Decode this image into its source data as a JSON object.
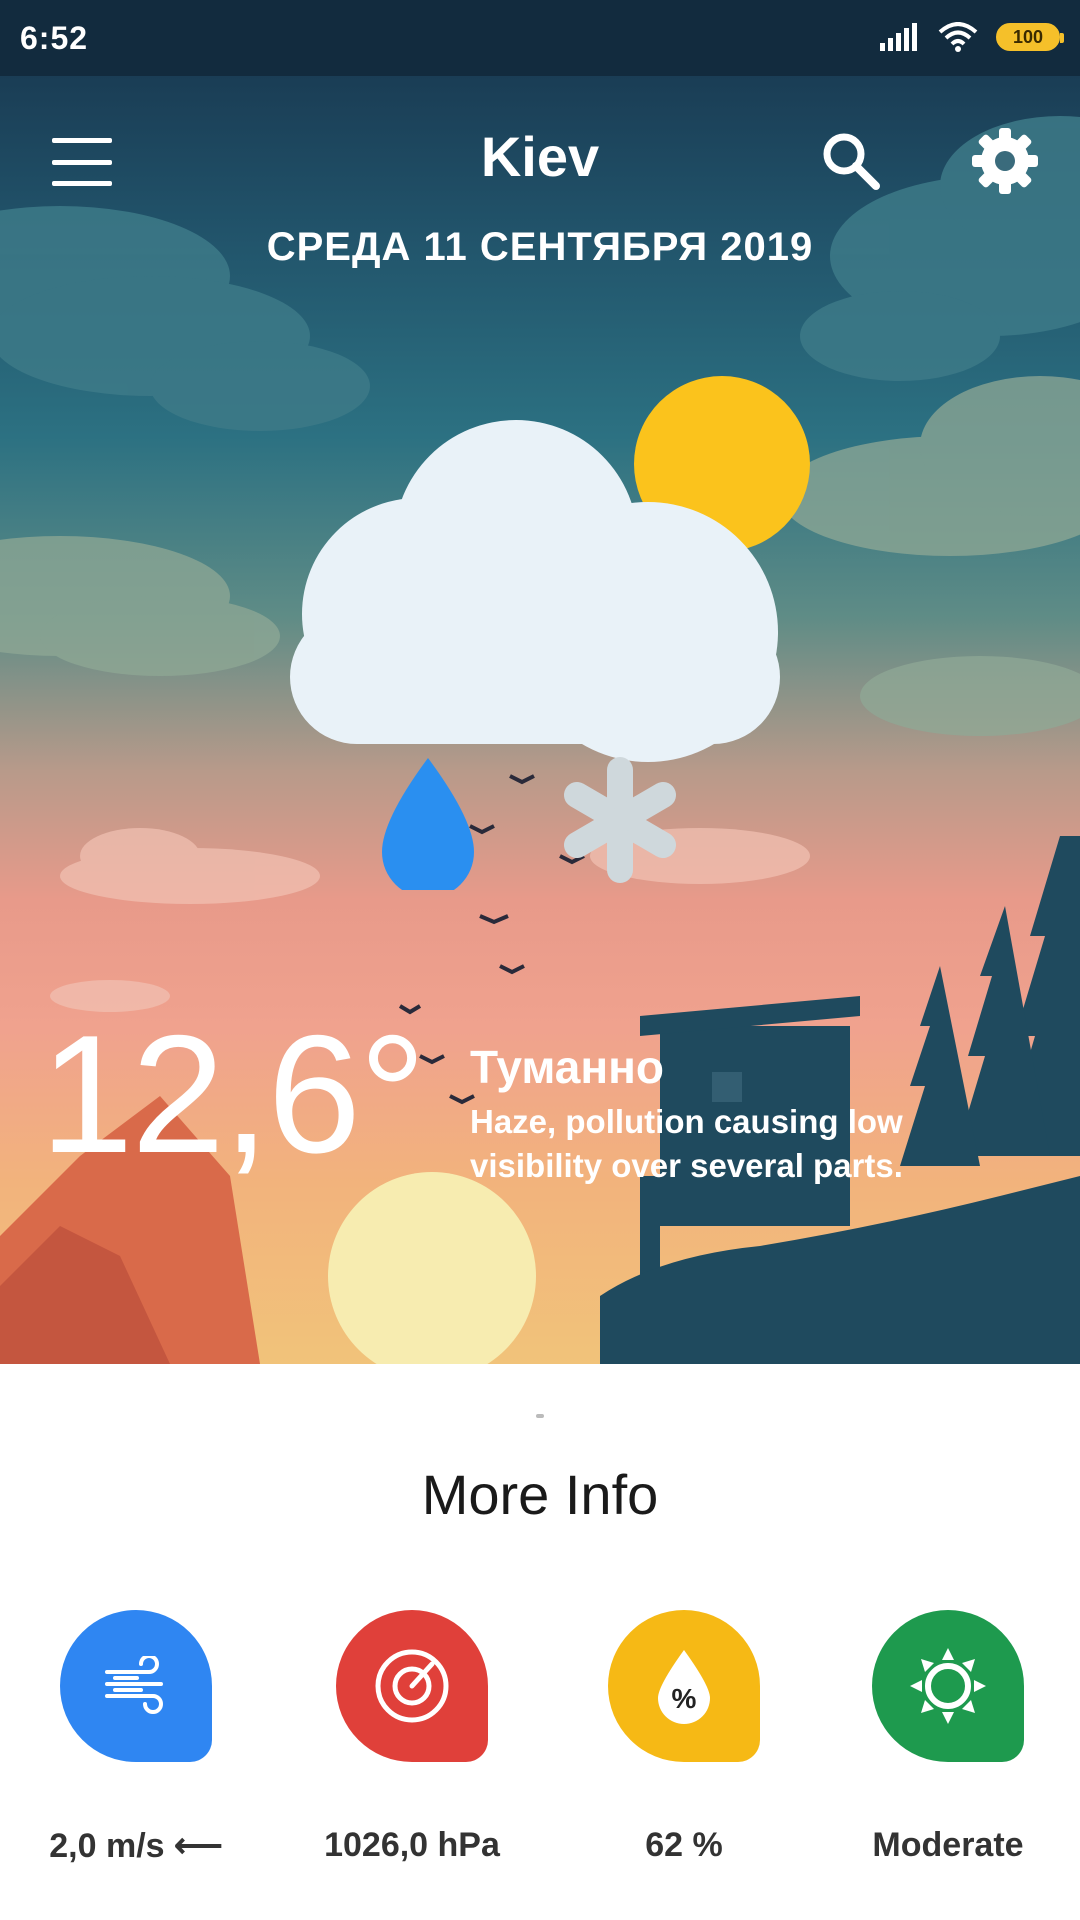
{
  "status_bar": {
    "time": "6:52",
    "battery": "100",
    "icons": [
      "signal-icon",
      "wifi-icon",
      "battery-icon"
    ]
  },
  "app_bar": {
    "city": "Kiev",
    "icons": [
      "menu-icon",
      "search-icon",
      "gear-icon"
    ]
  },
  "date": "СРЕДА 11 СЕНТЯБРЯ 2019",
  "weather": {
    "temperature": "12,6°",
    "condition": "Туманно",
    "description": "Haze, pollution causing low visibility over several parts.",
    "icon": "cloud-sun-rain-snow-icon"
  },
  "more_info": {
    "title": "More Info",
    "items": [
      {
        "icon": "wind-icon",
        "value": "2,0 m/s ⟵",
        "color": "#2f86f2"
      },
      {
        "icon": "pressure-gauge-icon",
        "value": "1026,0 hPa",
        "color": "#e0403a"
      },
      {
        "icon": "humidity-drop-icon",
        "value": "62 %",
        "color": "#f6b915"
      },
      {
        "icon": "sun-icon",
        "value": "Moderate",
        "color": "#1e9a4e"
      }
    ]
  },
  "colors": {
    "status_bar_bg": "#122b3e",
    "sun": "#fbc31c",
    "cloud": "#e9f2f8",
    "rain_drop": "#2a8ff0",
    "snow_flake": "#cfd8dc"
  }
}
